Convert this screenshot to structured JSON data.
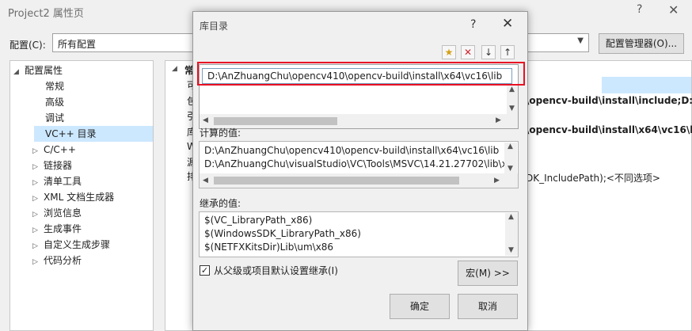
{
  "window": {
    "title": "Project2 属性页",
    "help_glyph": "?",
    "close_glyph": "✕",
    "config_label": "配置(C):",
    "config_value": "所有配置",
    "config_manager_label": "配置管理器(O)..."
  },
  "tree": {
    "items": [
      {
        "label": "配置属性",
        "arrow": "◢"
      },
      {
        "label": "常规"
      },
      {
        "label": "高级"
      },
      {
        "label": "调试"
      },
      {
        "label": "VC++ 目录"
      },
      {
        "label": "C/C++",
        "arrow": "▷"
      },
      {
        "label": "链接器",
        "arrow": "▷"
      },
      {
        "label": "清单工具",
        "arrow": "▷"
      },
      {
        "label": "XML 文档生成器",
        "arrow": "▷"
      },
      {
        "label": "浏览信息",
        "arrow": "▷"
      },
      {
        "label": "生成事件",
        "arrow": "▷"
      },
      {
        "label": "自定义生成步骤",
        "arrow": "▷"
      },
      {
        "label": "代码分析",
        "arrow": "▷"
      }
    ]
  },
  "grid": {
    "section_arrow": "◢",
    "section_initial": "常",
    "row_initials": [
      "可",
      "包",
      "引",
      "库",
      "W",
      "源",
      "排"
    ],
    "values": [
      "\\opencv-build\\install\\include;D:\\",
      "\\opencv-build\\install\\x64\\vc16\\l",
      ";",
      "DK_IncludePath);<不同选项>"
    ]
  },
  "dialog": {
    "title": "库目录",
    "help_glyph": "?",
    "close_glyph": "✕",
    "toolbar": {
      "new_folder_icon": "★",
      "delete_icon": "✕",
      "down_icon": "↓",
      "up_icon": "↑"
    },
    "entry": "D:\\AnZhuangChu\\opencv410\\opencv-build\\install\\x64\\vc16\\lib",
    "computed_label": "计算的值:",
    "computed_values": [
      "D:\\AnZhuangChu\\opencv410\\opencv-build\\install\\x64\\vc16\\lib",
      "D:\\AnZhuangChu\\visualStudio\\VC\\Tools\\MSVC\\14.21.27702\\lib\\x8"
    ],
    "inherited_label": "继承的值:",
    "inherited_values": [
      "$(VC_LibraryPath_x86)",
      "$(WindowsSDK_LibraryPath_x86)",
      "$(NETFXKitsDir)Lib\\um\\x86"
    ],
    "inherit_checkbox": {
      "label": "从父级或项目默认设置继承(I)",
      "checked": true,
      "glyph": "✓"
    },
    "macro_button": "宏(M) >>",
    "ok_button": "确定",
    "cancel_button": "取消"
  }
}
